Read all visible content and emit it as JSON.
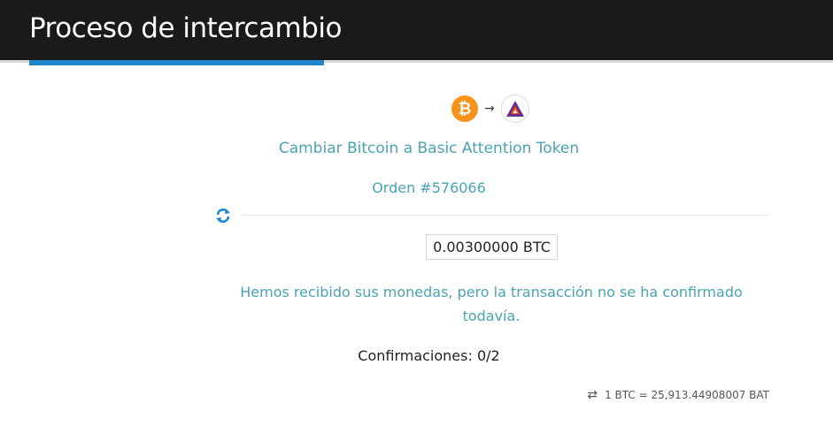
{
  "header": {
    "title": "Proceso de intercambio"
  },
  "exchange": {
    "from_coin_symbol": "₿",
    "arrow": "→",
    "description": "Cambiar Bitcoin a Basic Attention Token",
    "order": "Orden #576066",
    "amount": "0.00300000 BTC",
    "status_message": "Hemos recibido sus monedas, pero la transacción no se ha confirmado todavía.",
    "confirmations": "Confirmaciones: 0/2",
    "rate": "1 BTC = 25,913.44908007 BAT"
  },
  "icons": {
    "from": "bitcoin-icon",
    "to": "basic-attention-token-icon",
    "refresh": "refresh-icon",
    "rate": "swap-arrows-icon"
  },
  "colors": {
    "header_bg": "#1a1a1a",
    "accent": "#1f87c9",
    "teal_text": "#4aa3b3",
    "btc_orange": "#f7931a",
    "bat_purple": "#662d91",
    "bat_orange": "#ff5000"
  }
}
